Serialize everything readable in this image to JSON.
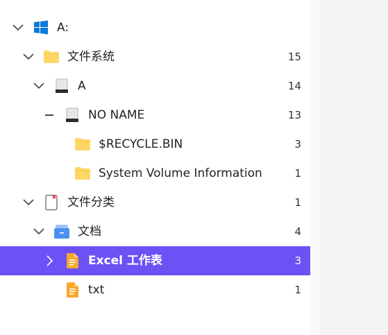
{
  "tree": [
    {
      "label": "A:",
      "count": "",
      "icon": "windows-icon",
      "toggle": "expanded"
    },
    {
      "label": "文件系统",
      "count": "15",
      "icon": "folder-icon",
      "toggle": "expanded"
    },
    {
      "label": "A",
      "count": "14",
      "icon": "drive-icon",
      "toggle": "expanded"
    },
    {
      "label": "NO NAME",
      "count": "13",
      "icon": "drive-icon",
      "toggle": "dash"
    },
    {
      "label": "$RECYCLE.BIN",
      "count": "3",
      "icon": "folder-icon",
      "toggle": "none"
    },
    {
      "label": "System Volume Information",
      "count": "1",
      "icon": "folder-icon",
      "toggle": "none"
    },
    {
      "label": "文件分类",
      "count": "1",
      "icon": "document-classify-icon",
      "toggle": "expanded"
    },
    {
      "label": "文档",
      "count": "4",
      "icon": "document-box-icon",
      "toggle": "expanded"
    },
    {
      "label": "Excel 工作表",
      "count": "3",
      "icon": "orange-file-icon",
      "toggle": "collapsed",
      "selected": true
    },
    {
      "label": "txt",
      "count": "1",
      "icon": "orange-file-icon",
      "toggle": "none"
    }
  ],
  "colors": {
    "selected_bg": "#6c52f5",
    "folder": "#ffd766",
    "windows_blue": "#0a78d7",
    "orange_file": "#f7a82b"
  }
}
